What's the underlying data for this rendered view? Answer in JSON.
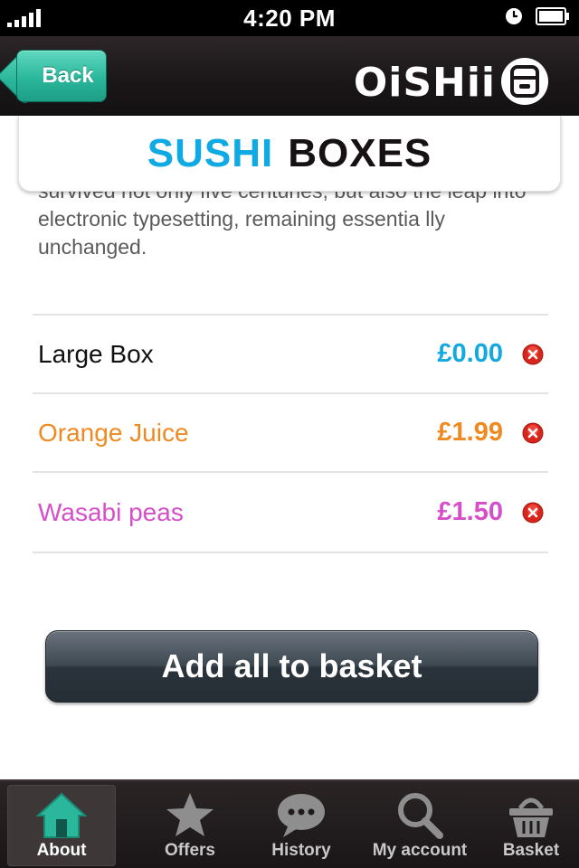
{
  "status_bar": {
    "time": "4:20 PM"
  },
  "nav": {
    "back_label": "Back",
    "brand": "OiSHii"
  },
  "title": {
    "word1": "SUSHI",
    "word2": "BOXES"
  },
  "description": "survived not only five centuries, but also the leap into electronic typesetting, remaining essentia lly unchanged.",
  "items": [
    {
      "name": "Large Box",
      "price": "£0.00",
      "name_color": "#111111",
      "price_color": "#12a8e0"
    },
    {
      "name": "Orange Juice",
      "price": "£1.99",
      "name_color": "#ef8a22",
      "price_color": "#ef8a22"
    },
    {
      "name": "Wasabi peas",
      "price": "£1.50",
      "name_color": "#d64fc9",
      "price_color": "#d64fc9"
    }
  ],
  "add_all_label": "Add all to basket",
  "tabs": [
    {
      "label": "About",
      "icon": "home-icon",
      "active": true
    },
    {
      "label": "Offers",
      "icon": "star-icon",
      "active": false
    },
    {
      "label": "History",
      "icon": "speech-bubble-icon",
      "active": false
    },
    {
      "label": "My account",
      "icon": "search-icon",
      "active": false
    },
    {
      "label": "Basket",
      "icon": "basket-icon",
      "active": false
    }
  ],
  "colors": {
    "accent_teal": "#2ab79b",
    "accent_blue": "#0fa9e3",
    "remove_red": "#d9261c"
  }
}
